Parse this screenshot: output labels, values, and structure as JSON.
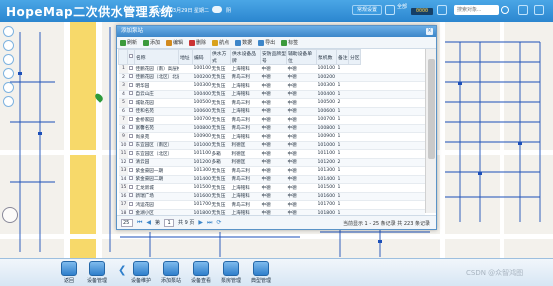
{
  "header": {
    "logo": "HopeMap二次供水管理系统",
    "datetime": "2018年03月29日 星期二",
    "weather": "阴",
    "btn_right1": "常规设置",
    "btn_right2": "系统设置",
    "total_label": "全部",
    "total_count": "0000",
    "search_placeholder": "搜索对象..."
  },
  "dialog": {
    "title": "添加泵站",
    "toolbar": [
      {
        "label": "刷新",
        "icon": "refresh-icon",
        "color": "#3c9a3c"
      },
      {
        "label": "添加",
        "icon": "add-icon",
        "color": "#3c9a3c"
      },
      {
        "label": "编辑",
        "icon": "edit-icon",
        "color": "#d28a1e"
      },
      {
        "label": "删除",
        "icon": "delete-icon",
        "color": "#cc3333"
      },
      {
        "label": "航点",
        "icon": "waypoint-icon",
        "color": "#d9a21c"
      },
      {
        "label": "数据",
        "icon": "data-icon",
        "color": "#3d86c9"
      },
      {
        "label": "导出",
        "icon": "export-icon",
        "color": "#3d86c9"
      },
      {
        "label": "标签",
        "icon": "tag-icon",
        "color": "#3c9a3c"
      }
    ],
    "columns": [
      "",
      "",
      "名称",
      "地址",
      "编码",
      "供水方式",
      "供水设备品牌",
      "安防品牌型号",
      "辅助设备单位",
      "泵机数",
      "备注",
      "分区"
    ],
    "rows": [
      [
        "1",
        "佳鹏花园（南）高层楼",
        "",
        "100100",
        "无负压",
        "上海铭科",
        "中德",
        "中德",
        "100100",
        "1",
        "",
        ""
      ],
      [
        "2",
        "佳鹏花园（北区）北层楼",
        "",
        "100200",
        "无负压",
        "青岛三利",
        "中德",
        "中德",
        "100200",
        "",
        "",
        ""
      ],
      [
        "3",
        "明华园",
        "",
        "100300",
        "无负压",
        "上海铭科",
        "中德",
        "中德",
        "100300",
        "1",
        "",
        ""
      ],
      [
        "4",
        "自云山庄",
        "",
        "100400",
        "无负压",
        "上海铭科",
        "中德",
        "中德",
        "100400",
        "1",
        "",
        ""
      ],
      [
        "5",
        "城轨花园",
        "",
        "100500",
        "无负压",
        "青岛三利",
        "中德",
        "中德",
        "100500",
        "2",
        "",
        ""
      ],
      [
        "6",
        "佳和名苑",
        "",
        "100600",
        "无负压",
        "上海铭科",
        "中德",
        "中德",
        "100600",
        "1",
        "",
        ""
      ],
      [
        "7",
        "金桥家园",
        "",
        "100700",
        "无负压",
        "青岛三利",
        "中德",
        "中德",
        "100700",
        "1",
        "",
        ""
      ],
      [
        "8",
        "富馨名苑",
        "",
        "100800",
        "无负压",
        "青岛三利",
        "中德",
        "中德",
        "100800",
        "1",
        "",
        ""
      ],
      [
        "9",
        "尚泉苑",
        "",
        "100900",
        "无负压",
        "上海铭科",
        "中德",
        "中德",
        "100900",
        "1",
        "",
        ""
      ],
      [
        "10",
        "东宜园区（南区）",
        "",
        "101000",
        "无负压",
        "利德匡",
        "中德",
        "中德",
        "101000",
        "1",
        "",
        ""
      ],
      [
        "11",
        "东宜园区（北区）",
        "",
        "101100",
        "多箱",
        "利德匡",
        "中德",
        "中德",
        "101100",
        "1",
        "",
        ""
      ],
      [
        "12",
        "清云园",
        "",
        "101200",
        "多箱",
        "利德匡",
        "中德",
        "中德",
        "101200",
        "2",
        "",
        ""
      ],
      [
        "13",
        "紫金豪园一期",
        "",
        "101300",
        "无负压",
        "青岛三利",
        "中德",
        "中德",
        "101300",
        "1",
        "",
        ""
      ],
      [
        "14",
        "紫金豪园二期",
        "",
        "101400",
        "无负压",
        "青岛三利",
        "中德",
        "中德",
        "101400",
        "1",
        "",
        ""
      ],
      [
        "15",
        "汇龙新城",
        "",
        "101500",
        "无负压",
        "上海铭科",
        "中德",
        "中德",
        "101500",
        "1",
        "",
        ""
      ],
      [
        "16",
        "新瑞广场",
        "",
        "101600",
        "无负压",
        "上海铭科",
        "中德",
        "中德",
        "101600",
        "1",
        "",
        ""
      ],
      [
        "17",
        "鸿运花园",
        "",
        "101700",
        "无负压",
        "青岛三利",
        "中德",
        "中德",
        "101700",
        "1",
        "",
        ""
      ],
      [
        "18",
        "金湖小区",
        "",
        "101800",
        "无负压",
        "上海铭科",
        "中德",
        "中德",
        "101800",
        "1",
        "",
        ""
      ]
    ],
    "pager": {
      "page_size": "25",
      "page_prefix": "第",
      "page_value": "1",
      "page_suffix": "共 9 页",
      "info": "当前显示 1 - 25 条记录 共 223 条记录"
    }
  },
  "bottom": {
    "items": [
      {
        "label": "返回",
        "icon": "back-icon"
      },
      {
        "label": "设备管理",
        "icon": "device-manage-icon"
      },
      {
        "label": "设备维护",
        "icon": "maintain-icon"
      },
      {
        "label": "添加泵站",
        "icon": "add-station-icon"
      },
      {
        "label": "设备查看",
        "icon": "device-view-icon"
      },
      {
        "label": "泵房管理",
        "icon": "pump-room-icon"
      },
      {
        "label": "典型管理",
        "icon": "typical-icon"
      }
    ]
  },
  "watermark": "CSDN @众智鸿图"
}
